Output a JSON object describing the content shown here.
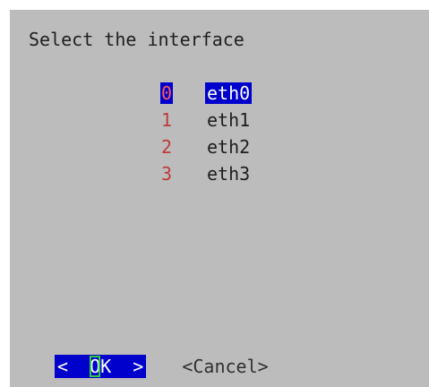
{
  "dialog": {
    "title": "Select the interface",
    "items": [
      {
        "key": "0",
        "label": "eth0",
        "selected": true
      },
      {
        "key": "1",
        "label": "eth1",
        "selected": false
      },
      {
        "key": "2",
        "label": "eth2",
        "selected": false
      },
      {
        "key": "3",
        "label": "eth3",
        "selected": false
      }
    ]
  },
  "buttons": {
    "ok_left": "<  ",
    "ok_hot": "O",
    "ok_rest": "K",
    "ok_right": "  >",
    "cancel": "<Cancel>"
  },
  "colors": {
    "dialog_bg": "#bcbcbc",
    "highlight": "#0000cc",
    "hotkey_number": "#c0393b",
    "focus_outline": "#2ecc40"
  }
}
